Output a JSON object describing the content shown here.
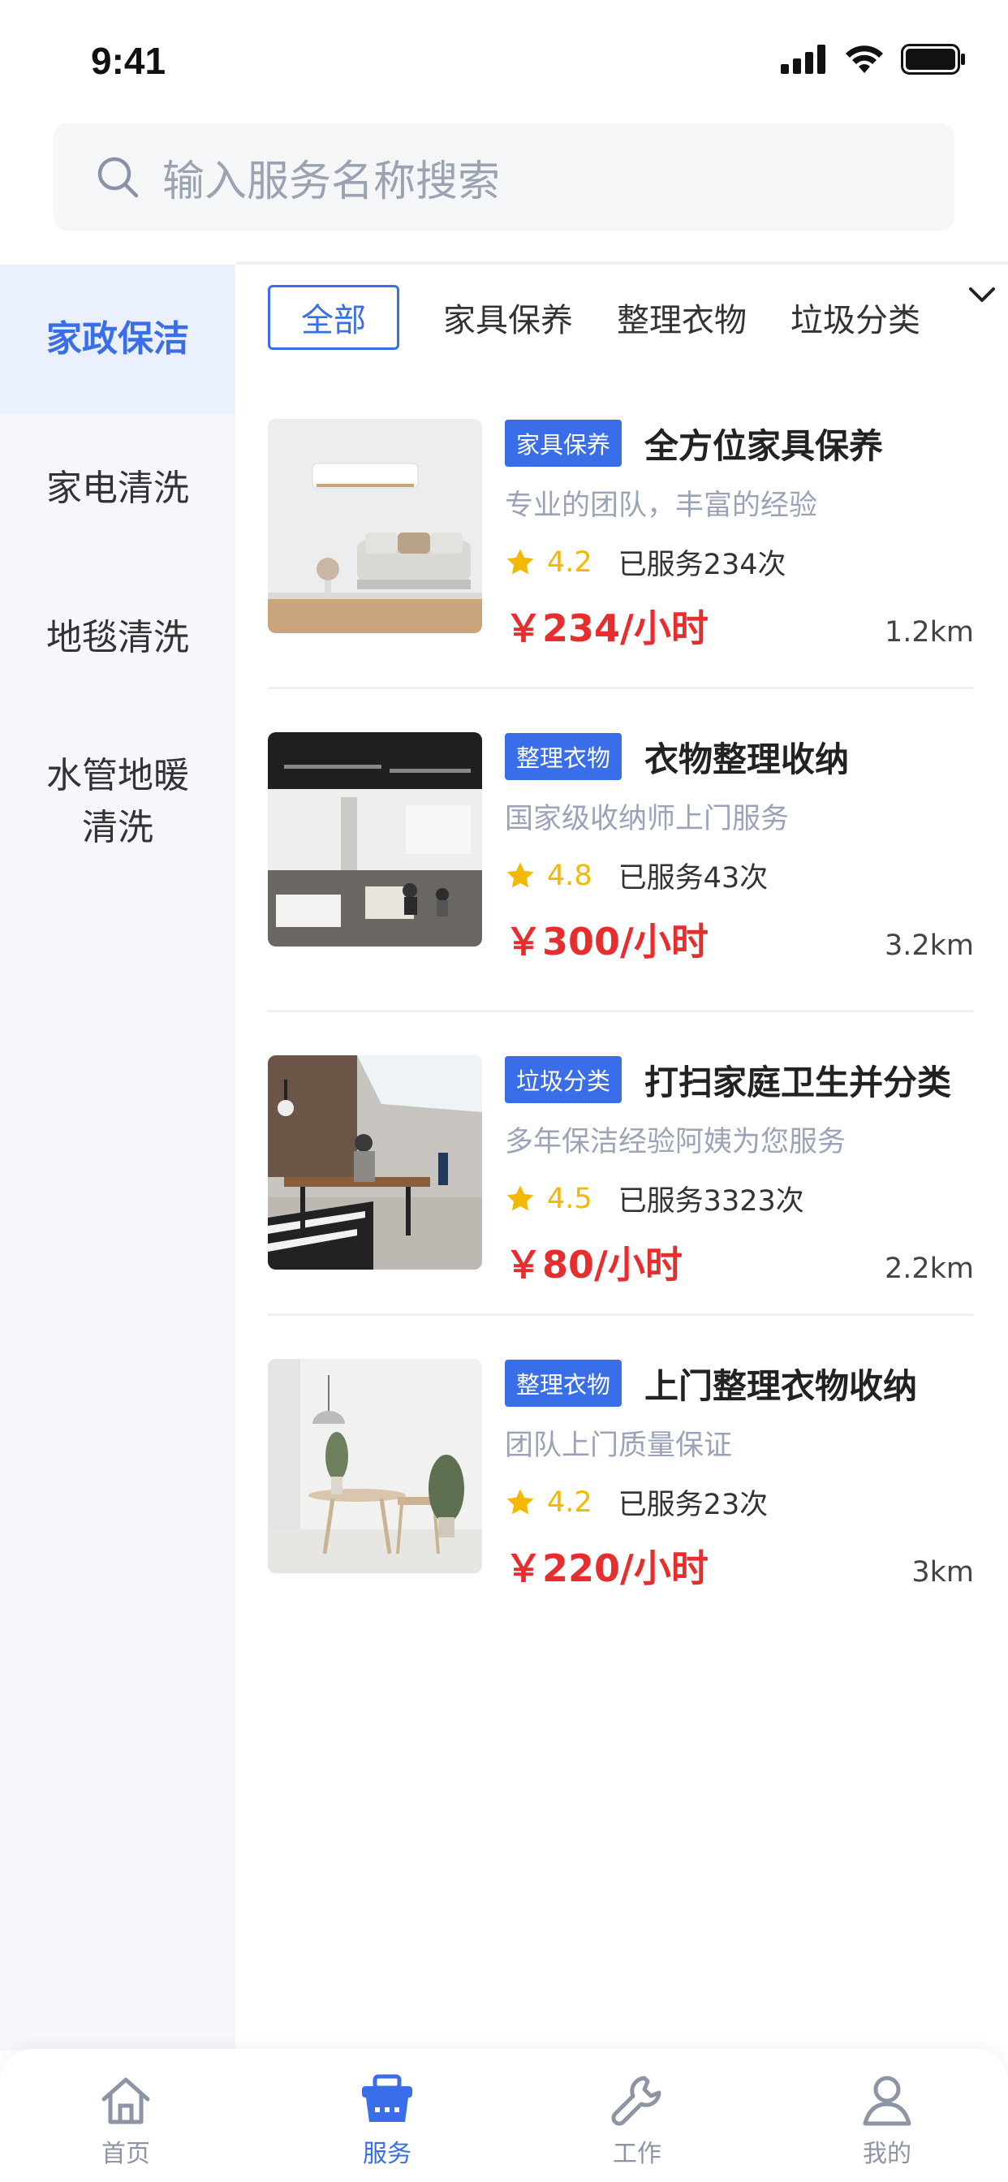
{
  "status_bar": {
    "time": "9:41"
  },
  "search": {
    "placeholder": "输入服务名称搜索"
  },
  "sidebar": {
    "items": [
      {
        "label": "家政保洁",
        "active": true
      },
      {
        "label": "家电清洗",
        "active": false
      },
      {
        "label": "地毯清洗",
        "active": false
      },
      {
        "label_line1": "水管地暖",
        "label_line2": "清洗",
        "active": false
      }
    ]
  },
  "filters": {
    "items": [
      "全部",
      "家具保养",
      "整理衣物",
      "垃圾分类"
    ],
    "active": "全部"
  },
  "services": [
    {
      "tag": "家具保养",
      "title": "全方位家具保养",
      "desc": "专业的团队，丰富的经验",
      "rating": "4.2",
      "served": "已服务234次",
      "price": "￥234/小时",
      "distance": "1.2km"
    },
    {
      "tag": "整理衣物",
      "title": "衣物整理收纳",
      "desc": "国家级收纳师上门服务",
      "rating": "4.8",
      "served": "已服务43次",
      "price": "￥300/小时",
      "distance": "3.2km"
    },
    {
      "tag": "垃圾分类",
      "title": "打扫家庭卫生并分类",
      "desc": "多年保洁经验阿姨为您服务",
      "rating": "4.5",
      "served": "已服务3323次",
      "price": "￥80/小时",
      "distance": "2.2km"
    },
    {
      "tag": "整理衣物",
      "title": "上门整理衣物收纳",
      "desc": "团队上门质量保证",
      "rating": "4.2",
      "served": "已服务23次",
      "price": "￥220/小时",
      "distance": "3km"
    }
  ],
  "tabbar": {
    "items": [
      {
        "label": "首页",
        "icon": "home-icon",
        "active": false
      },
      {
        "label": "服务",
        "icon": "basket-icon",
        "active": true
      },
      {
        "label": "工作",
        "icon": "wrench-icon",
        "active": false
      },
      {
        "label": "我的",
        "icon": "user-icon",
        "active": false
      }
    ]
  },
  "colors": {
    "accent": "#3a6de8",
    "price": "#e62e2e",
    "star": "#f5b800"
  }
}
